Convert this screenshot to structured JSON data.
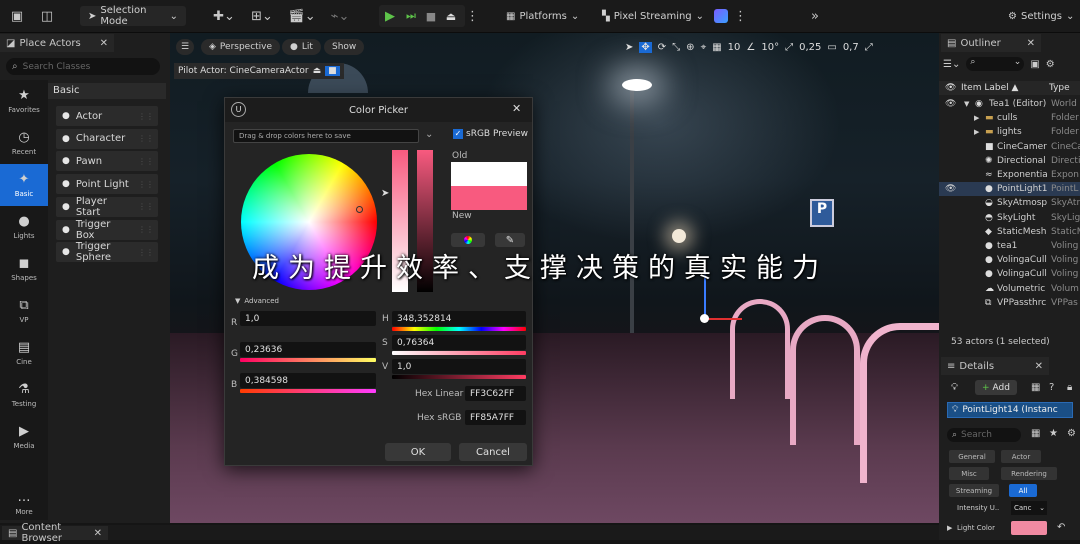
{
  "toolbar": {
    "selection_mode": "Selection Mode",
    "platforms": "Platforms",
    "pixel_streaming": "Pixel Streaming",
    "settings": "Settings"
  },
  "place_actors": {
    "tab_title": "Place Actors",
    "search_placeholder": "Search Classes",
    "section": "Basic",
    "categories": [
      {
        "label": "Favorites",
        "icon": "star-icon"
      },
      {
        "label": "Recent",
        "icon": "clock-icon"
      },
      {
        "label": "Basic",
        "icon": "shapes-icon"
      },
      {
        "label": "Lights",
        "icon": "bulb-icon"
      },
      {
        "label": "Shapes",
        "icon": "cube-icon"
      },
      {
        "label": "VP",
        "icon": "vp-icon"
      },
      {
        "label": "Cine",
        "icon": "clapper-icon"
      },
      {
        "label": "Testing",
        "icon": "flask-icon"
      },
      {
        "label": "Media",
        "icon": "media-icon"
      },
      {
        "label": "More",
        "icon": "ellipsis-icon"
      }
    ],
    "items": [
      "Actor",
      "Character",
      "Pawn",
      "Point Light",
      "Player Start",
      "Trigger Box",
      "Trigger Sphere"
    ]
  },
  "viewport": {
    "perspective": "Perspective",
    "lit": "Lit",
    "show": "Show",
    "pilot": "Pilot Actor: CineCameraActor",
    "grid_value": "10",
    "angle_value": "10°",
    "scale_value": "0,25",
    "camera_speed": "0,7"
  },
  "color_picker": {
    "title": "Color Picker",
    "drag_hint": "Drag & drop colors here to save",
    "srgb_preview": "sRGB Preview",
    "old_label": "Old",
    "new_label": "New",
    "old_color": "#ffffff",
    "new_color": "#f85a7f",
    "advanced": "Advanced",
    "r_label": "R",
    "r_value": "1,0",
    "g_label": "G",
    "g_value": "0,23636",
    "b_label": "B",
    "b_value": "0,384598",
    "h_label": "H",
    "h_value": "348,352814",
    "s_label": "S",
    "s_value": "0,76364",
    "v_label": "V",
    "v_value": "1,0",
    "hex_linear_label": "Hex Linear",
    "hex_linear": "FF3C62FF",
    "hex_srgb_label": "Hex sRGB",
    "hex_srgb": "FF85A7FF",
    "ok": "OK",
    "cancel": "Cancel"
  },
  "subtitle": "成为提升效率、支撑决策的真实能力",
  "outliner": {
    "tab_title": "Outliner",
    "col_label": "Item Label ▲",
    "col_type": "Type",
    "rows": [
      {
        "name": "Tea1 (Editor)",
        "type": "World",
        "indent": 0,
        "icon": "world-icon"
      },
      {
        "name": "culls",
        "type": "Folder",
        "indent": 1,
        "icon": "folder-icon"
      },
      {
        "name": "lights",
        "type": "Folder",
        "indent": 1,
        "icon": "folder-icon"
      },
      {
        "name": "CineCamer",
        "type": "CineCa",
        "indent": 1,
        "icon": "camera-icon"
      },
      {
        "name": "Directional",
        "type": "Directi",
        "indent": 1,
        "icon": "sun-icon"
      },
      {
        "name": "Exponentia",
        "type": "Expon",
        "indent": 1,
        "icon": "fog-icon"
      },
      {
        "name": "PointLight1",
        "type": "PointL",
        "indent": 1,
        "icon": "bulb-icon"
      },
      {
        "name": "SkyAtmosp",
        "type": "SkyAtr",
        "indent": 1,
        "icon": "sky-icon"
      },
      {
        "name": "SkyLight",
        "type": "SkyLig",
        "indent": 1,
        "icon": "skylight-icon"
      },
      {
        "name": "StaticMesh",
        "type": "StaticM",
        "indent": 1,
        "icon": "mesh-icon"
      },
      {
        "name": "tea1",
        "type": "Voling",
        "indent": 1,
        "icon": "actor-icon"
      },
      {
        "name": "VolingaCull",
        "type": "Voling",
        "indent": 1,
        "icon": "actor-icon"
      },
      {
        "name": "VolingaCull",
        "type": "Voling",
        "indent": 1,
        "icon": "actor-icon"
      },
      {
        "name": "Volumetric",
        "type": "Volum",
        "indent": 1,
        "icon": "cloud-icon"
      },
      {
        "name": "VPPassthrc",
        "type": "VPPas",
        "indent": 1,
        "icon": "vp-icon"
      }
    ],
    "count": "53 actors (1 selected)"
  },
  "details": {
    "tab_title": "Details",
    "add": "Add",
    "object": "PointLight14 (Instanc",
    "search_placeholder": "Search",
    "chips": [
      "General",
      "Actor",
      "Misc",
      "Rendering",
      "Streaming",
      "All"
    ],
    "intensity_label": "Intensity U..",
    "intensity_value": "Canc",
    "light_color_label": "Light Color",
    "light_color": "#f18aa2"
  },
  "content_browser": "Content Browser"
}
